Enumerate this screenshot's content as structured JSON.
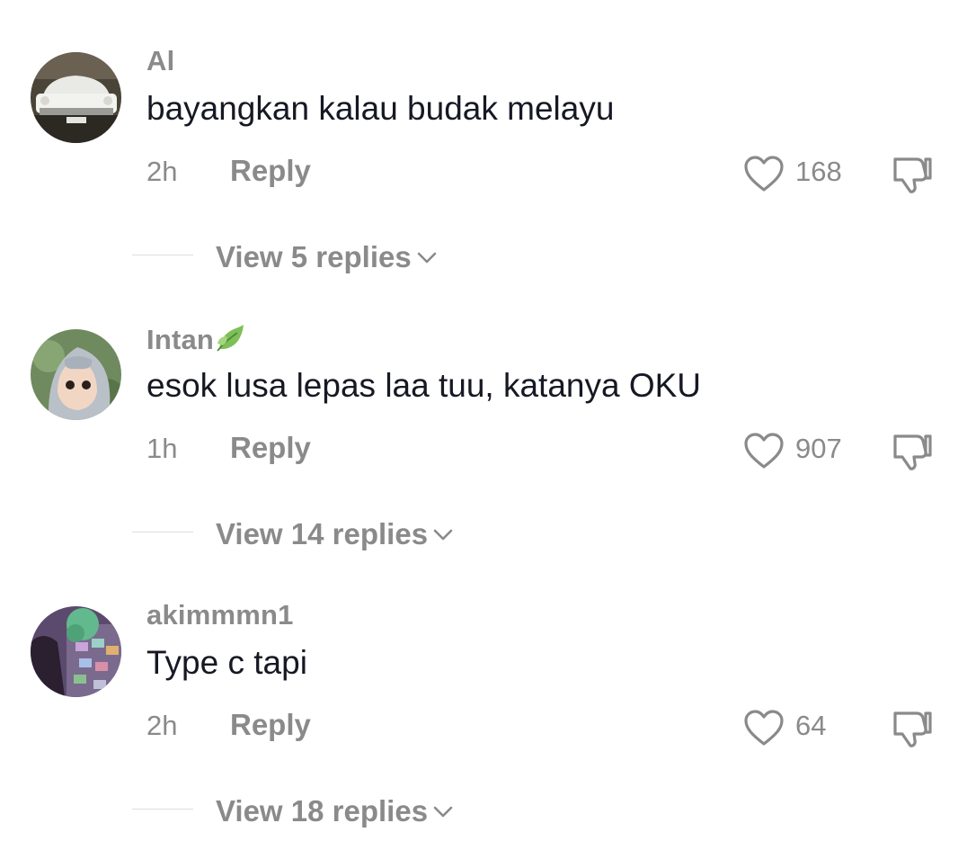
{
  "colors": {
    "background": "#ffffff",
    "text_primary": "#161823",
    "text_secondary": "#8a8a8a",
    "divider": "#dddddd"
  },
  "comments": [
    {
      "username": "Al",
      "avatar_icon": "vintage-car-avatar",
      "text": "bayangkan kalau budak melayu",
      "time": "2h",
      "reply_label": "Reply",
      "likes": "168",
      "like_icon": "heart-outline-icon",
      "dislike_icon": "thumbs-down-icon",
      "view_replies_label": "View 5 replies"
    },
    {
      "username": "Intan",
      "username_badge_icon": "leaf-emoji-icon",
      "avatar_icon": "hijab-girl-avatar",
      "text": "esok lusa lepas laa tuu, katanya OKU",
      "time": "1h",
      "reply_label": "Reply",
      "likes": "907",
      "like_icon": "heart-outline-icon",
      "dislike_icon": "thumbs-down-icon",
      "view_replies_label": "View 14 replies"
    },
    {
      "username": "akimmmn1",
      "avatar_icon": "market-photo-avatar",
      "text": "Type c tapi",
      "time": "2h",
      "reply_label": "Reply",
      "likes": "64",
      "like_icon": "heart-outline-icon",
      "dislike_icon": "thumbs-down-icon",
      "view_replies_label": "View 18 replies"
    }
  ]
}
